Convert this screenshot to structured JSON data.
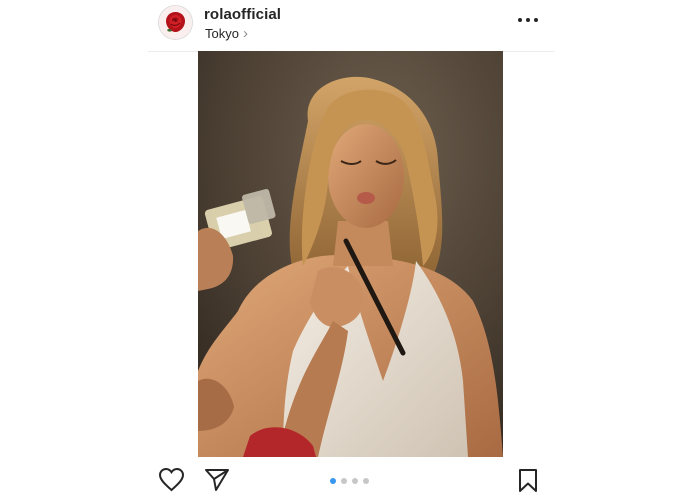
{
  "post": {
    "username": "rolaofficial",
    "location": "Tokyo",
    "location_chevron": "›",
    "media_count": 4,
    "active_media_index": 1
  },
  "colors": {
    "pager_active": "#3897f0",
    "pager_inactive": "#c7c7c7",
    "icon": "#262626"
  },
  "icons": {
    "avatar": "rose-avatar",
    "more": "more-options-icon",
    "like": "heart-icon",
    "share": "paper-plane-icon",
    "save": "bookmark-icon"
  }
}
